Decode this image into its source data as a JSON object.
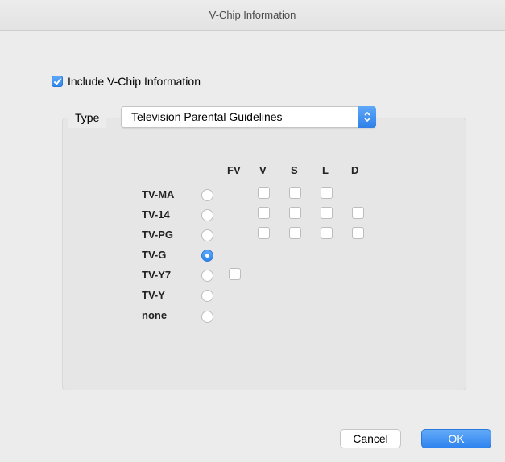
{
  "window": {
    "title": "V-Chip Information"
  },
  "include_vchip": {
    "label": "Include V-Chip Information",
    "checked": true
  },
  "type_group": {
    "label": "Type",
    "selected": "Television Parental Guidelines"
  },
  "columns": [
    "FV",
    "V",
    "S",
    "L",
    "D"
  ],
  "ratings": [
    {
      "label": "TV-MA",
      "selected": false,
      "checkboxes": [
        "V",
        "S",
        "L"
      ]
    },
    {
      "label": "TV-14",
      "selected": false,
      "checkboxes": [
        "V",
        "S",
        "L",
        "D"
      ]
    },
    {
      "label": "TV-PG",
      "selected": false,
      "checkboxes": [
        "V",
        "S",
        "L",
        "D"
      ]
    },
    {
      "label": "TV-G",
      "selected": true,
      "checkboxes": []
    },
    {
      "label": "TV-Y7",
      "selected": false,
      "checkboxes": [
        "FV"
      ]
    },
    {
      "label": "TV-Y",
      "selected": false,
      "checkboxes": []
    },
    {
      "label": "none",
      "selected": false,
      "checkboxes": []
    }
  ],
  "buttons": {
    "cancel": "Cancel",
    "ok": "OK"
  },
  "colors": {
    "accent": "#3a8ff3",
    "window_bg": "#ececec"
  }
}
